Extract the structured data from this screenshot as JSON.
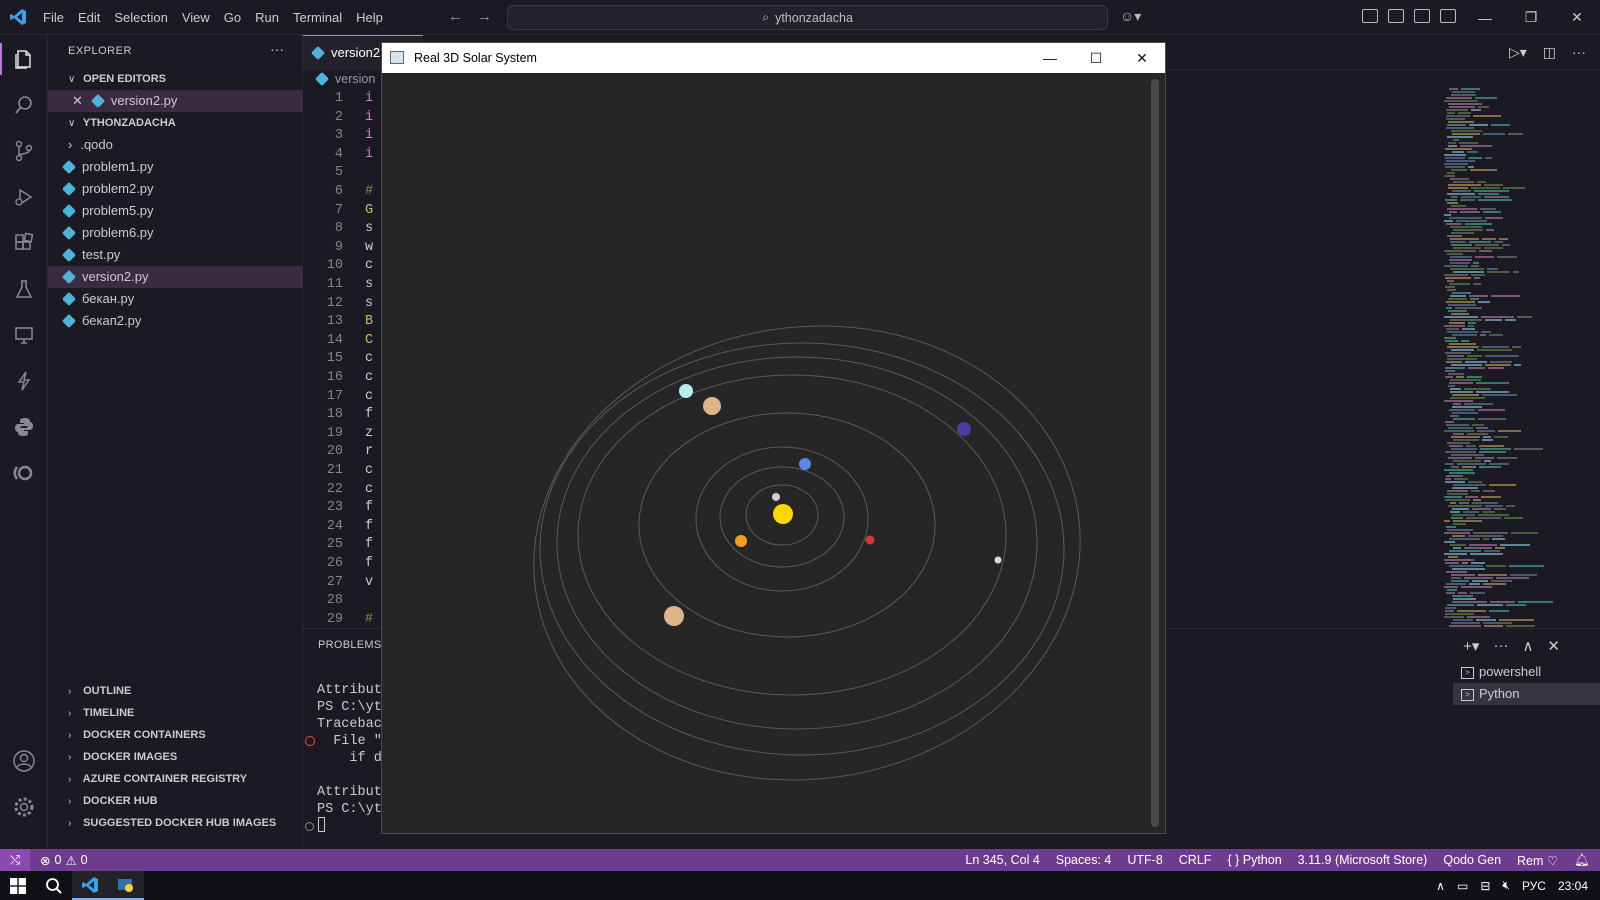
{
  "titlebar": {
    "menu": [
      "File",
      "Edit",
      "Selection",
      "View",
      "Go",
      "Run",
      "Terminal",
      "Help"
    ],
    "search": "ythonzadacha"
  },
  "sidebar": {
    "header": "EXPLORER",
    "open_editors_label": "OPEN EDITORS",
    "open_file": "version2.py",
    "folder_label": "YTHONZADACHA",
    "files": [
      ".qodo",
      "problem1.py",
      "problem2.py",
      "problem5.py",
      "problem6.py",
      "test.py",
      "version2.py",
      "бекан.py",
      "бекап2.py"
    ],
    "sections": [
      "OUTLINE",
      "TIMELINE",
      "DOCKER CONTAINERS",
      "DOCKER IMAGES",
      "AZURE CONTAINER REGISTRY",
      "DOCKER HUB",
      "SUGGESTED DOCKER HUB IMAGES"
    ]
  },
  "editor": {
    "tab": "version2",
    "breadcrumb": "version",
    "lines": [
      {
        "n": "1",
        "t": "i"
      },
      {
        "n": "2",
        "t": "i"
      },
      {
        "n": "3",
        "t": "i"
      },
      {
        "n": "4",
        "t": "i"
      },
      {
        "n": "5",
        "t": ""
      },
      {
        "n": "6",
        "t": "#"
      },
      {
        "n": "7",
        "t": "G"
      },
      {
        "n": "8",
        "t": "s"
      },
      {
        "n": "9",
        "t": "w"
      },
      {
        "n": "10",
        "t": "c"
      },
      {
        "n": "11",
        "t": "s"
      },
      {
        "n": "12",
        "t": "s"
      },
      {
        "n": "13",
        "t": "B"
      },
      {
        "n": "14",
        "t": "C"
      },
      {
        "n": "15",
        "t": "c"
      },
      {
        "n": "16",
        "t": "c"
      },
      {
        "n": "17",
        "t": "c"
      },
      {
        "n": "18",
        "t": "f"
      },
      {
        "n": "19",
        "t": "z"
      },
      {
        "n": "20",
        "t": "r"
      },
      {
        "n": "21",
        "t": "c"
      },
      {
        "n": "22",
        "t": "c"
      },
      {
        "n": "23",
        "t": "f"
      },
      {
        "n": "24",
        "t": "f"
      },
      {
        "n": "25",
        "t": "f"
      },
      {
        "n": "26",
        "t": "f"
      },
      {
        "n": "27",
        "t": "v"
      },
      {
        "n": "28",
        "t": ""
      },
      {
        "n": "29",
        "t": "#"
      }
    ]
  },
  "panel": {
    "tab": "PROBLEMS",
    "terminal_lines": [
      "Attribut",
      "PS C:\\yt",
      "Tracebac",
      "  File \"",
      "    if d",
      "",
      "Attribut",
      "PS C:\\yt"
    ],
    "terminals": [
      "powershell",
      "Python"
    ]
  },
  "solar_window": {
    "title": "Real 3D Solar System",
    "colors": {
      "sun": "#ffd700",
      "orbit": "#5a5a5a",
      "background": "#262626"
    }
  },
  "status": {
    "problems": "0",
    "warnings": "0",
    "position": "Ln 345, Col 4",
    "spaces": "Spaces: 4",
    "encoding": "UTF-8",
    "eol": "CRLF",
    "language": "Python",
    "interpreter": "3.11.9 (Microsoft Store)",
    "qodo": "Qodo Gen",
    "rem": "Rem"
  },
  "taskbar": {
    "lang": "РУС",
    "time": "23:04"
  }
}
